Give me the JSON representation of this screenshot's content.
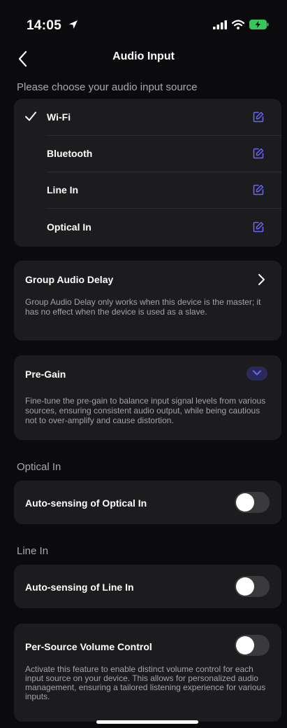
{
  "status_bar": {
    "time": "14:05",
    "icons": [
      "location-arrow-icon",
      "cellular-signal-icon",
      "wifi-icon",
      "battery-charging-icon"
    ],
    "battery_color": "#34c759"
  },
  "nav": {
    "back_icon": "chevron-left-icon",
    "title": "Audio Input"
  },
  "sources": {
    "heading": "Please choose your audio input source",
    "selected": "Wi-Fi",
    "items": [
      {
        "label": "Wi-Fi",
        "selected": true
      },
      {
        "label": "Bluetooth",
        "selected": false
      },
      {
        "label": "Line In",
        "selected": false
      },
      {
        "label": "Optical In",
        "selected": false
      }
    ],
    "accent_color": "#6b63f7"
  },
  "group_delay": {
    "title": "Group Audio Delay",
    "description": "Group Audio Delay only works when this device is the master; it has no effect when the device is used as a slave."
  },
  "pre_gain": {
    "title": "Pre-Gain",
    "description": "Fine-tune the pre-gain to balance input signal levels from various sources, ensuring consistent audio output, while being cautious not to over-amplify and cause distortion."
  },
  "optical_section": {
    "heading": "Optical In",
    "toggle_label": "Auto-sensing of Optical In",
    "enabled": false
  },
  "line_section": {
    "heading": "Line In",
    "toggle_label": "Auto-sensing of Line In",
    "enabled": false
  },
  "volume_control": {
    "title": "Per-Source Volume Control",
    "enabled": false,
    "description": "Activate this feature to enable distinct volume control for each input source on your device. This allows for personalized audio management, ensuring a tailored listening experience for various inputs."
  }
}
